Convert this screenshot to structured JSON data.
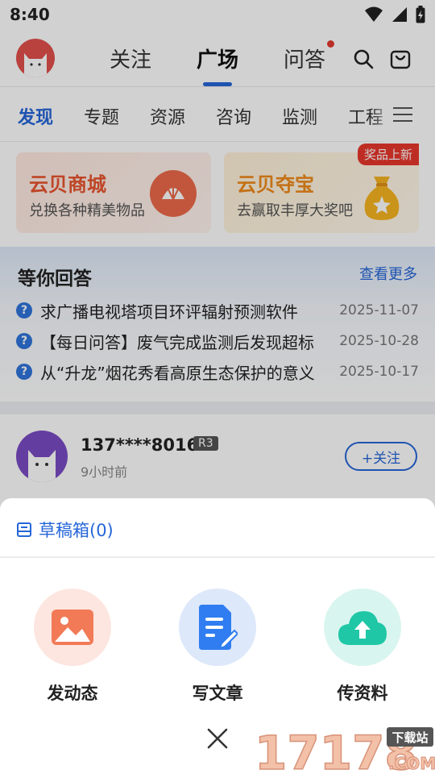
{
  "status_bar": {
    "time": "8:40"
  },
  "top_nav": {
    "tabs": [
      {
        "label": "关注"
      },
      {
        "label": "广场",
        "active": true
      },
      {
        "label": "问答",
        "has_dot": true
      }
    ]
  },
  "categories": [
    "发现",
    "专题",
    "资源",
    "咨询",
    "监测",
    "工程"
  ],
  "promos": [
    {
      "title": "云贝商城",
      "subtitle": "兑换各种精美物品"
    },
    {
      "title": "云贝夺宝",
      "subtitle": "去赢取丰厚大奖吧",
      "badge": "奖品上新"
    }
  ],
  "answers": {
    "title": "等你回答",
    "more": "查看更多",
    "items": [
      {
        "text": "求广播电视塔项目环评辐射预测软件",
        "date": "2025-11-07"
      },
      {
        "text": "【每日问答】废气完成监测后发现超标",
        "date": "2025-10-28"
      },
      {
        "text": "从“升龙”烟花秀看高原生态保护的意义",
        "date": "2025-10-17"
      }
    ]
  },
  "post": {
    "username": "137****8016",
    "rank": "R3",
    "time": "9小时前",
    "follow_label": "+关注"
  },
  "sheet": {
    "drafts_label": "草稿箱(0)",
    "actions": [
      {
        "label": "发动态",
        "icon": "image-icon"
      },
      {
        "label": "写文章",
        "icon": "document-edit-icon"
      },
      {
        "label": "传资料",
        "icon": "cloud-upload-icon"
      }
    ]
  },
  "watermark": {
    "text": "17178",
    "sub": "下载站",
    "tld": ".COM"
  },
  "colors": {
    "accent": "#2566d8",
    "promo_red": "#e8552f",
    "promo_orange": "#f08a1a"
  }
}
